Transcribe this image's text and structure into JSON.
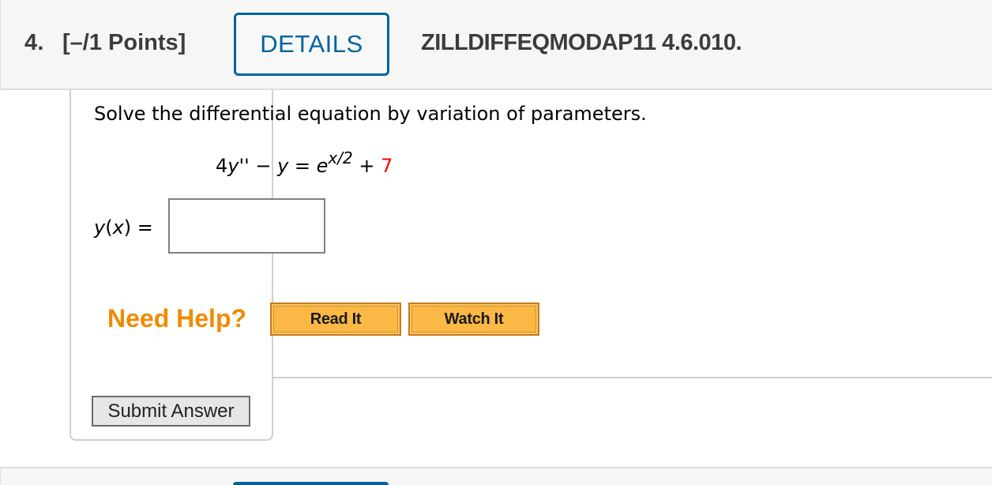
{
  "question": {
    "number": "4.",
    "points": "[–/1 Points]",
    "details_label": "DETAILS",
    "code": "ZILLDIFFEQMODAP11 4.6.010."
  },
  "problem": {
    "prompt": "Solve the differential equation by variation of parameters.",
    "equation": {
      "lhs_coef": "4",
      "lhs_var1": "y",
      "lhs_prime": "''",
      "minus": " − ",
      "lhs_var2": "y",
      "equals": " = ",
      "base": "e",
      "exponent": "x/2",
      "plus": " + ",
      "constant": "7"
    },
    "answer_label": {
      "func": "y",
      "open": "(",
      "arg": "x",
      "close": ")",
      "equals": " ="
    },
    "answer_value": ""
  },
  "help": {
    "label": "Need Help?",
    "read_it": "Read It",
    "watch_it": "Watch It"
  },
  "actions": {
    "submit": "Submit Answer"
  },
  "colors": {
    "accent_blue": "#00639c",
    "help_orange": "#f08a00",
    "button_orange": "#fbb844",
    "randomized_value_red": "#ff0000"
  }
}
